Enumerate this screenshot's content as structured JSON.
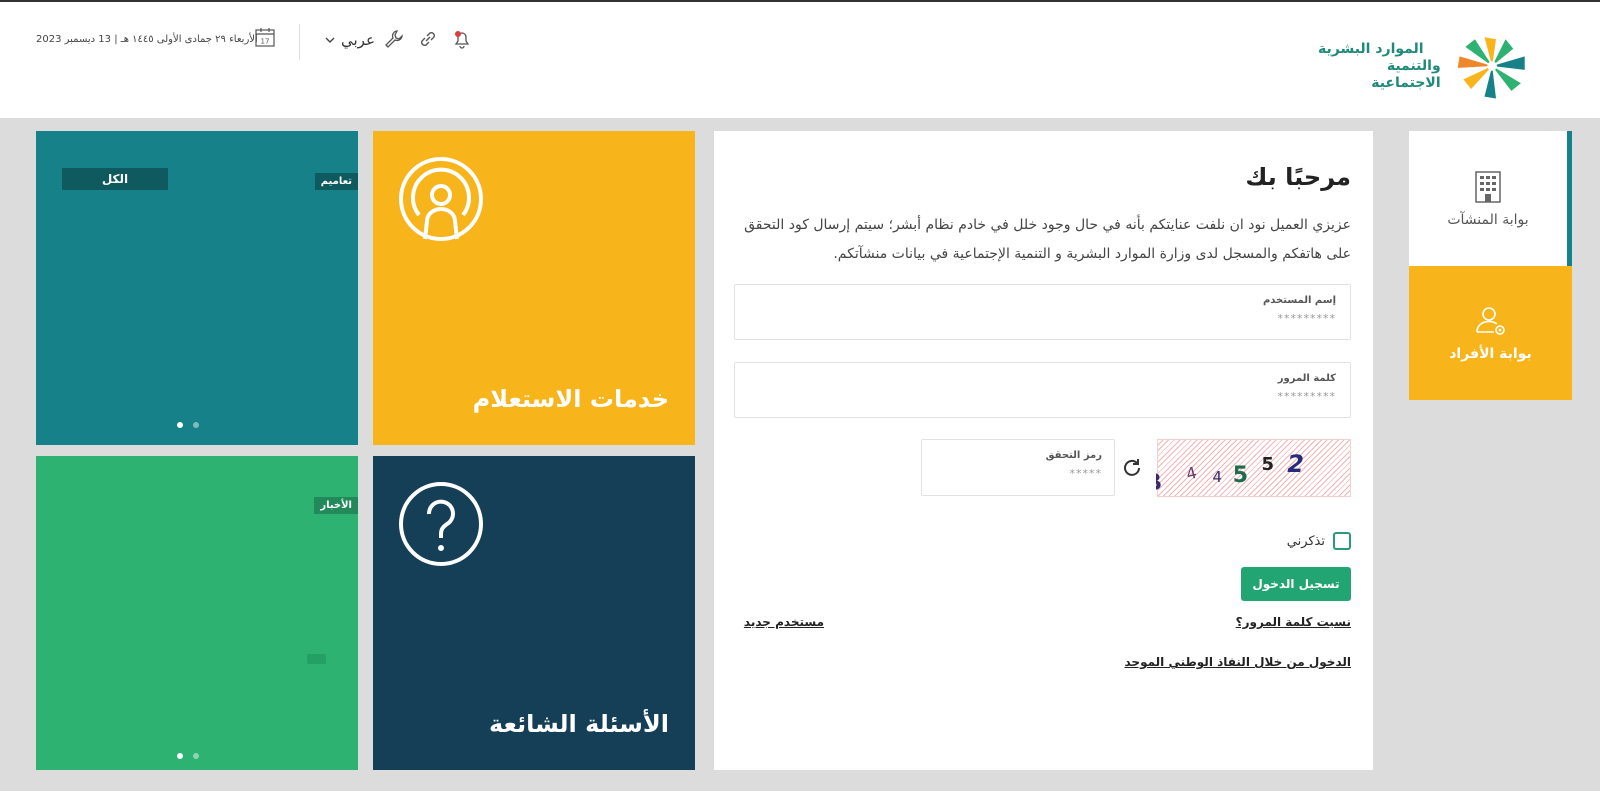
{
  "header": {
    "ministry_line1": "الموارد البشرية",
    "ministry_line2": "والتنمية الاجتماعية",
    "date_text": "الأربعاء ٢٩ جمادى الأولى ١٤٤٥ هـ | 13 ديسمبر 2023",
    "calendar_day": "17",
    "language_label": "عربي",
    "icons": [
      "notification-bell-icon",
      "link-icon",
      "wrench-icon",
      "chevron-down-icon",
      "calendar-icon"
    ]
  },
  "portals": {
    "establishments_label": "بوابة المنشآت",
    "individuals_label": "بوابة الأفراد"
  },
  "login": {
    "title": "مرحبًا بك",
    "description": "عزيزي العميل نود ان نلفت عنايتكم بأنه في حال وجود خلل في خادم نظام أبشر؛ سيتم إرسال كود التحقق على هاتفكم والمسجل لدى وزارة الموارد البشرية و التنمية الإجتماعية في بيانات منشآتكم.",
    "username_label": "إسم المستخدم",
    "username_placeholder": "*********",
    "password_label": "كلمة المرور",
    "password_placeholder": "*********",
    "captcha_label": "رمز التحقق",
    "captcha_placeholder": "*****",
    "captcha_text": [
      "3",
      "4",
      "4",
      "5",
      "5",
      "2"
    ],
    "remember_label": "تذكرني",
    "login_button": "تسجيل الدخول",
    "forgot_password": "نسيت كلمة المرور؟",
    "new_user": "مستخدم جديد",
    "nafath_login": "الدخول من خلال النفاذ الوطني الموحد"
  },
  "tiles": {
    "services_title": "خدمات الاستعلام",
    "faq_title": "الأسئلة الشائعة",
    "circulars_tag": "تعاميم",
    "all_button": "الكل",
    "news_tag": "الأخبار"
  },
  "colors": {
    "yellow": "#f8b41b",
    "teal": "#168189",
    "navy": "#153f57",
    "green": "#2eb271",
    "button_green": "#23a473"
  }
}
